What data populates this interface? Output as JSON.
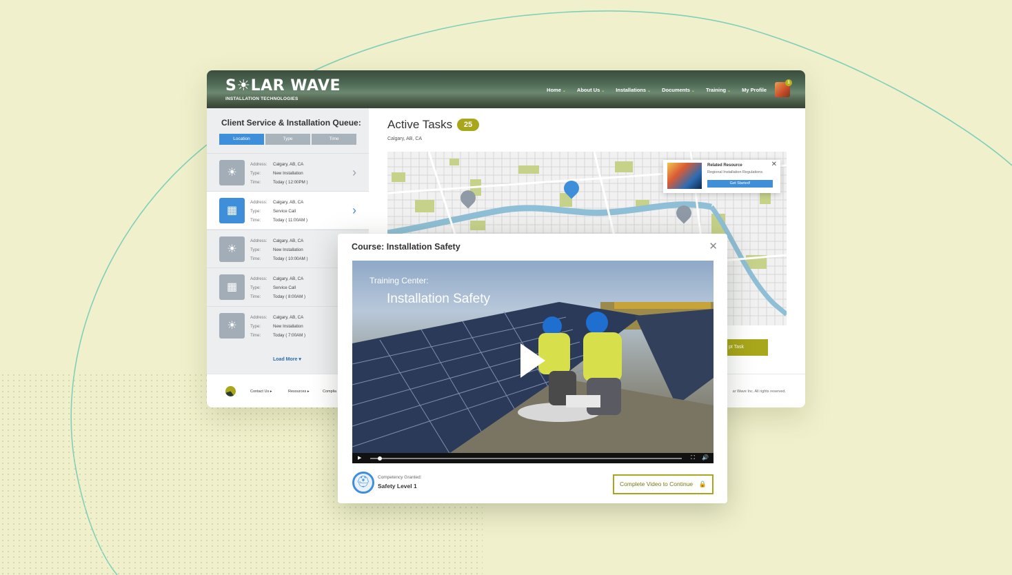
{
  "brand": {
    "name": "S☀LAR WAVE",
    "tagline": "INSTALLATION TECHNOLOGIES"
  },
  "nav": [
    {
      "label": "Home"
    },
    {
      "label": "About Us"
    },
    {
      "label": "Installations"
    },
    {
      "label": "Documents"
    },
    {
      "label": "Training"
    },
    {
      "label": "My Profile"
    }
  ],
  "profile": {
    "notification_count": "1"
  },
  "queue": {
    "title": "Client Service & Installation Queue:",
    "filters": [
      "Location",
      "Type",
      "Time"
    ],
    "labels": {
      "address": "Address:",
      "type": "Type:",
      "time": "Time:"
    },
    "items": [
      {
        "icon": "solar-panel-icon",
        "address": "Calgary, AB, CA",
        "type": "New Installation",
        "time": "Today ( 12:00PM )"
      },
      {
        "icon": "calendar-icon",
        "address": "Calgary, AB, CA",
        "type": "Service Call",
        "time": "Today ( 11:00AM )"
      },
      {
        "icon": "solar-panel-icon",
        "address": "Calgary, AB, CA",
        "type": "New Installation",
        "time": "Today ( 10:00AM )"
      },
      {
        "icon": "calendar-icon",
        "address": "Calgary, AB, CA",
        "type": "Service Call",
        "time": "Today ( 8:00AM )"
      },
      {
        "icon": "solar-panel-icon",
        "address": "Calgary, AB, CA",
        "type": "New Installation",
        "time": "Today ( 7:00AM )"
      }
    ],
    "load_more": "Load More ▾"
  },
  "tasks": {
    "title": "Active Tasks",
    "count": "25",
    "location": "Calgary, AB, CA",
    "accept_label": "pt Task"
  },
  "resource": {
    "title": "Related Resource",
    "subtitle": "Regional Installation Regulations",
    "button": "Get Started!"
  },
  "footer": {
    "links": [
      "Contact Us ▸",
      "Resources ▸",
      "Complia"
    ],
    "copyright": "ar Wave Inc. All rights reserved."
  },
  "course": {
    "title": "Course: Installation Safety",
    "video_overline": "Training Center:",
    "video_title": "Installation Safety",
    "video_progress": 0.03,
    "competency_label": "Competency Granted:",
    "competency_value": "Safety Level 1",
    "continue_label": "Complete Video to Continue"
  },
  "colors": {
    "accent_olive": "#a8a61a",
    "accent_blue": "#3f8ed9",
    "background": "#f0f0cc"
  }
}
